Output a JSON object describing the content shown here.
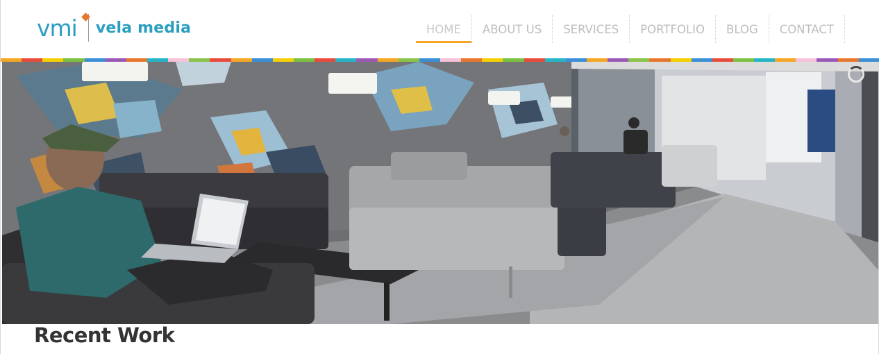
{
  "brand": {
    "logo_mark": "vmi",
    "name": "vela media",
    "color": "#2a9ec0",
    "dot_color": "#e8772e"
  },
  "nav": {
    "accent": "#f5a623",
    "items": [
      {
        "label": "HOME",
        "active": true
      },
      {
        "label": "ABOUT US",
        "active": false
      },
      {
        "label": "SERVICES",
        "active": false
      },
      {
        "label": "PORTFOLIO",
        "active": false
      },
      {
        "label": "BLOG",
        "active": false
      },
      {
        "label": "CONTACT",
        "active": false
      }
    ]
  },
  "strip_colors": [
    "#f5a623",
    "#e84b3c",
    "#f5d000",
    "#7cc142",
    "#3a8fd6",
    "#9b59b6",
    "#e8772e",
    "#26b5c8",
    "#f7c1d9",
    "#8bc34a",
    "#e84b3c",
    "#f5a623",
    "#3a8fd6",
    "#f5d000",
    "#7cc142",
    "#e84b3c",
    "#26b5c8",
    "#9b59b6",
    "#f5a623",
    "#8bc34a",
    "#3a8fd6",
    "#f7c1d9",
    "#e8772e",
    "#f5d000",
    "#7cc142",
    "#e84b3c",
    "#26b5c8",
    "#3a8fd6",
    "#f5a623",
    "#9b59b6",
    "#8bc34a",
    "#e8772e",
    "#f5d000",
    "#3a8fd6",
    "#e84b3c",
    "#7cc142",
    "#26b5c8",
    "#f5a623",
    "#f7c1d9",
    "#9b59b6",
    "#e8772e",
    "#3a8fd6"
  ],
  "hero": {
    "image_subject": "office-lounge-photo",
    "slider_state": "loading-spinner-icon"
  },
  "recent_work": {
    "title": "Recent Work"
  }
}
